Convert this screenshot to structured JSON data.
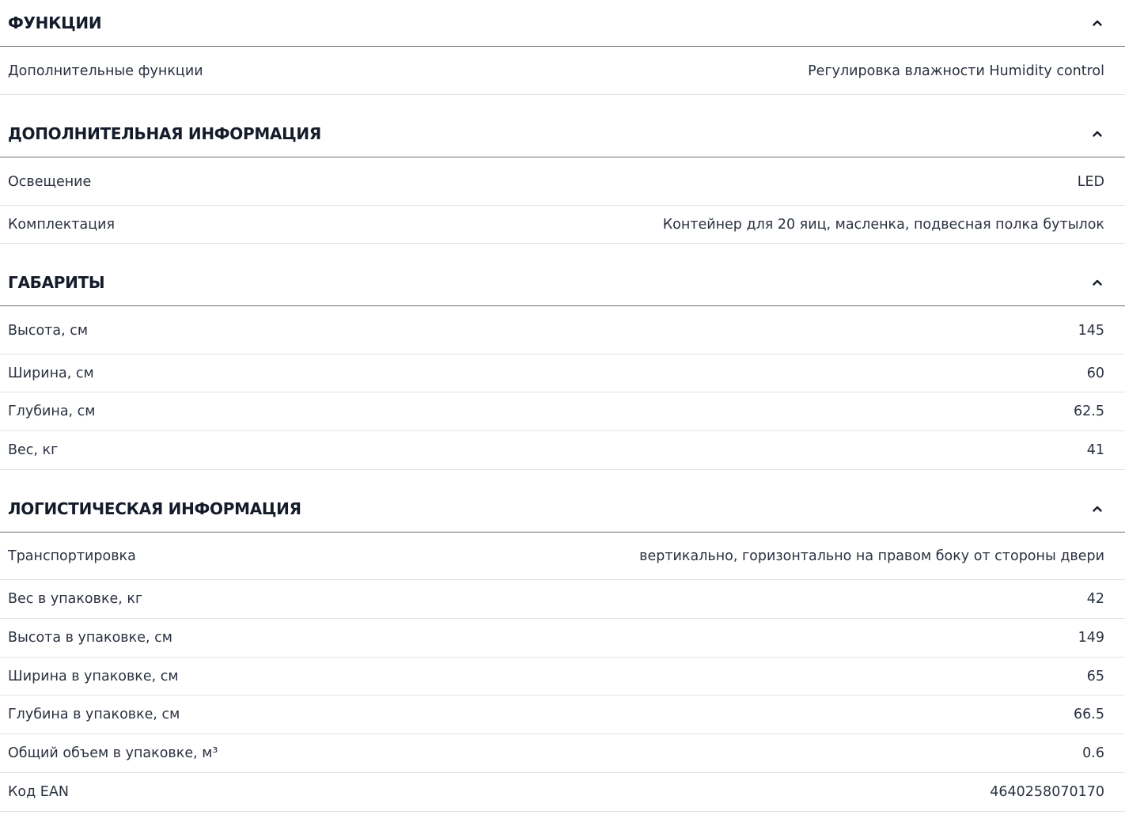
{
  "sections": [
    {
      "title": "ФУНКЦИИ",
      "icon": "chevron-up-icon",
      "rows": [
        {
          "label": "Дополнительные функции",
          "value": "Регулировка влажности Humidity control"
        }
      ]
    },
    {
      "title": "ДОПОЛНИТЕЛЬНАЯ ИНФОРМАЦИЯ",
      "icon": "chevron-up-icon",
      "rows": [
        {
          "label": "Освещение",
          "value": "LED"
        },
        {
          "label": "Комплектация",
          "value": "Контейнер для 20 яиц, масленка, подвесная полка бутылок"
        }
      ]
    },
    {
      "title": "ГАБАРИТЫ",
      "icon": "chevron-up-icon",
      "rows": [
        {
          "label": "Высота, см",
          "value": "145"
        },
        {
          "label": "Ширина, см",
          "value": "60"
        },
        {
          "label": "Глубина, см",
          "value": "62.5"
        },
        {
          "label": "Вес, кг",
          "value": "41"
        }
      ]
    },
    {
      "title": "ЛОГИСТИЧЕСКАЯ ИНФОРМАЦИЯ",
      "icon": "chevron-up-icon",
      "rows": [
        {
          "label": "Транспортировка",
          "value": "вертикально, горизонтально на правом боку от стороны двери"
        },
        {
          "label": "Вес в упаковке, кг",
          "value": "42"
        },
        {
          "label": "Высота в упаковке, см",
          "value": "149"
        },
        {
          "label": "Ширина в упаковке, см",
          "value": "65"
        },
        {
          "label": "Глубина в упаковке, см",
          "value": "66.5"
        },
        {
          "label": "Общий объем в упаковке, м³",
          "value": "0.6"
        },
        {
          "label": "Код EAN",
          "value": "4640258070170"
        }
      ]
    }
  ]
}
